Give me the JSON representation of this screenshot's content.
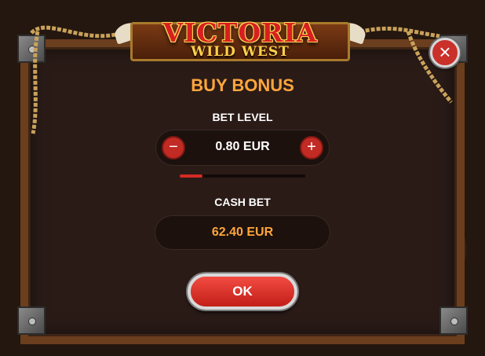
{
  "logo": {
    "title": "VICTORIA",
    "subtitle": "WILD WEST"
  },
  "dialog": {
    "heading": "BUY BONUS",
    "bet_level_label": "BET LEVEL",
    "bet_level_value": "0.80 EUR",
    "minus_symbol": "−",
    "plus_symbol": "+",
    "bet_slider_level": 0.18,
    "cash_bet_label": "CASH BET",
    "cash_bet_value": "62.40 EUR",
    "ok_label": "OK",
    "close_symbol": "×"
  },
  "colors": {
    "accent_orange": "#ffa63c",
    "button_red": "#c22a24",
    "frame_brown": "#6b3e1e",
    "panel_bg": "#2a1b17"
  },
  "icons": [
    "close-icon",
    "minus-icon",
    "plus-icon",
    "rope-decoration",
    "bull-horns-icon"
  ]
}
